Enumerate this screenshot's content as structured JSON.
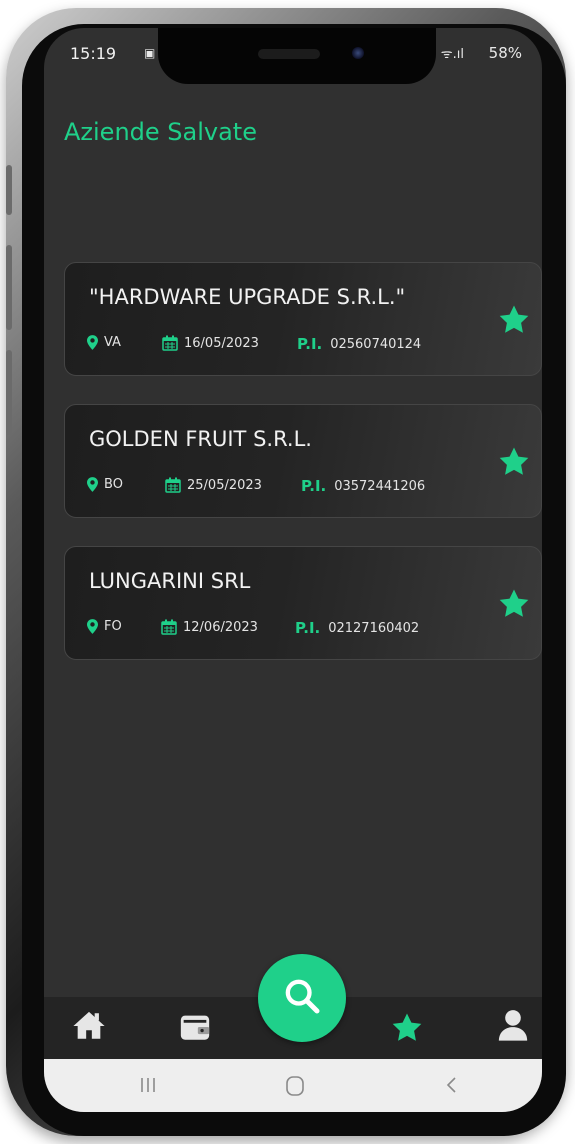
{
  "status_bar": {
    "time": "15:19",
    "battery": "58%"
  },
  "page": {
    "title": "Aziende Salvate"
  },
  "companies": [
    {
      "name": "\"HARDWARE UPGRADE S.R.L.\"",
      "province": "VA",
      "date": "16/05/2023",
      "pi_label": "P.I.",
      "pi": "02560740124",
      "saved": true
    },
    {
      "name": "GOLDEN FRUIT S.R.L.",
      "province": "BO",
      "date": "25/05/2023",
      "pi_label": "P.I.",
      "pi": "03572441206",
      "saved": true
    },
    {
      "name": "LUNGARINI SRL",
      "province": "FO",
      "date": "12/06/2023",
      "pi_label": "P.I.",
      "pi": "02127160402",
      "saved": true
    }
  ],
  "nav": {
    "items": [
      {
        "icon": "home-icon",
        "active": false
      },
      {
        "icon": "wallet-icon",
        "active": false
      },
      {
        "icon": "search-icon",
        "active": false
      },
      {
        "icon": "star-icon",
        "active": true
      },
      {
        "icon": "user-icon",
        "active": false
      }
    ]
  },
  "colors": {
    "accent": "#1fd08a",
    "background": "#303030",
    "card": "#242424",
    "text": "#f2f2f2"
  }
}
